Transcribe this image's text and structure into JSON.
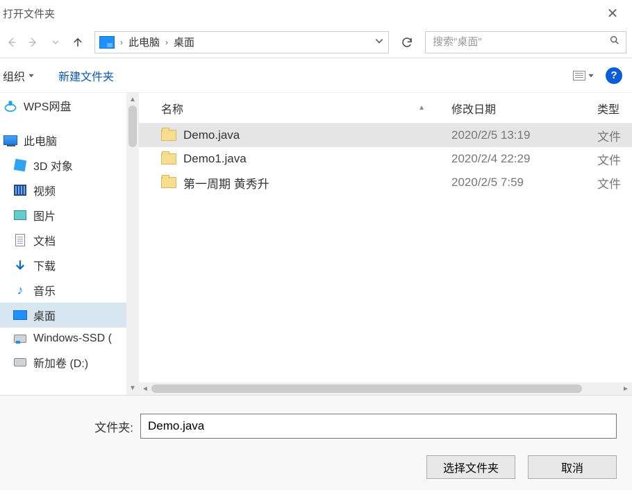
{
  "titlebar": {
    "title": "打开文件夹"
  },
  "nav": {
    "breadcrumb": [
      "此电脑",
      "桌面"
    ]
  },
  "search": {
    "placeholder": "搜索\"桌面\""
  },
  "toolbar": {
    "organize": "组织",
    "newfolder": "新建文件夹"
  },
  "sidebar": {
    "items": [
      {
        "label": "WPS网盘",
        "icon": "wps",
        "indent": false
      },
      {
        "label": "此电脑",
        "icon": "pc",
        "indent": false
      },
      {
        "label": "3D 对象",
        "icon": "3d",
        "indent": true
      },
      {
        "label": "视频",
        "icon": "video",
        "indent": true
      },
      {
        "label": "图片",
        "icon": "pic",
        "indent": true
      },
      {
        "label": "文档",
        "icon": "doc",
        "indent": true
      },
      {
        "label": "下载",
        "icon": "dl",
        "indent": true
      },
      {
        "label": "音乐",
        "icon": "music",
        "indent": true
      },
      {
        "label": "桌面",
        "icon": "desktop",
        "indent": true,
        "selected": true
      },
      {
        "label": "Windows-SSD (",
        "icon": "ssd",
        "indent": true
      },
      {
        "label": "新加卷 (D:)",
        "icon": "disk",
        "indent": true
      }
    ]
  },
  "filelist": {
    "columns": {
      "name": "名称",
      "date": "修改日期",
      "type": "类型"
    },
    "type_trunc": "文件",
    "rows": [
      {
        "name": "Demo.java",
        "date": "2020/2/5 13:19",
        "selected": true
      },
      {
        "name": "Demo1.java",
        "date": "2020/2/4 22:29"
      },
      {
        "name": "第一周期 黄秀升",
        "date": "2020/2/5 7:59"
      }
    ]
  },
  "footer": {
    "field_label": "文件夹:",
    "field_value": "Demo.java",
    "select_label": "选择文件夹",
    "cancel_label": "取消"
  }
}
